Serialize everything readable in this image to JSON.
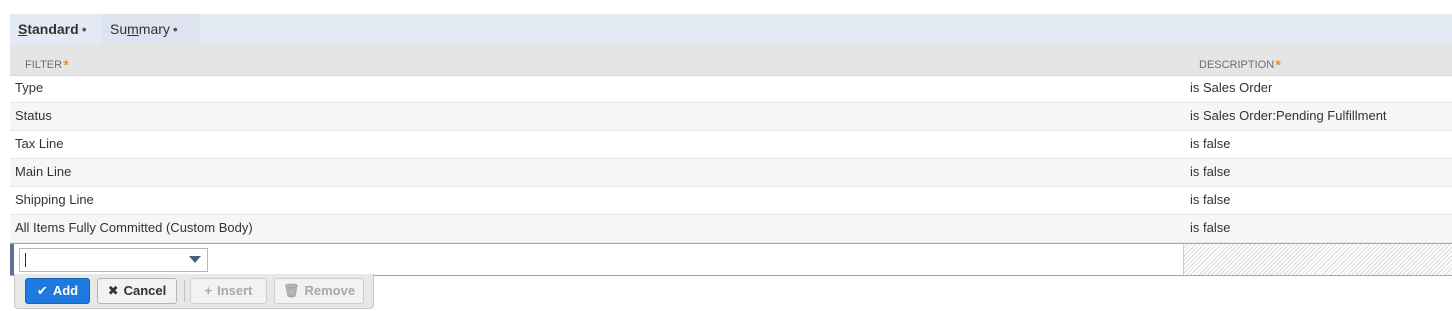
{
  "tabs": [
    {
      "label_pre": "",
      "label_u": "S",
      "label_post": "tandard",
      "dot": "•",
      "active": true
    },
    {
      "label_pre": "Su",
      "label_u": "m",
      "label_post": "mary",
      "dot": "•",
      "active": false
    }
  ],
  "table": {
    "headers": {
      "filter": "FILTER",
      "description": "DESCRIPTION",
      "required_marker": "*"
    },
    "rows": [
      {
        "filter": "Type",
        "description": "is Sales Order"
      },
      {
        "filter": "Status",
        "description": "is Sales Order:Pending Fulfillment"
      },
      {
        "filter": "Tax Line",
        "description": "is false"
      },
      {
        "filter": "Main Line",
        "description": "is false"
      },
      {
        "filter": "Shipping Line",
        "description": "is false"
      },
      {
        "filter": "All Items Fully Committed (Custom Body)",
        "description": "is false"
      }
    ]
  },
  "edit_row": {
    "filter_value": "",
    "dropdown_icon": "chevron-down-icon"
  },
  "actions": {
    "add": {
      "label": "Add",
      "icon": "checkmark-icon",
      "glyph": "✔"
    },
    "cancel": {
      "label": "Cancel",
      "icon": "x-icon",
      "glyph": "✖"
    },
    "insert": {
      "label": "Insert",
      "icon": "plus-icon",
      "glyph": "+"
    },
    "remove": {
      "label": "Remove",
      "icon": "trash-icon",
      "glyph": "🗑"
    }
  },
  "colors": {
    "accent": "#1f7ae0",
    "required": "#e07b00",
    "tabbar": "#e4eaf3"
  }
}
